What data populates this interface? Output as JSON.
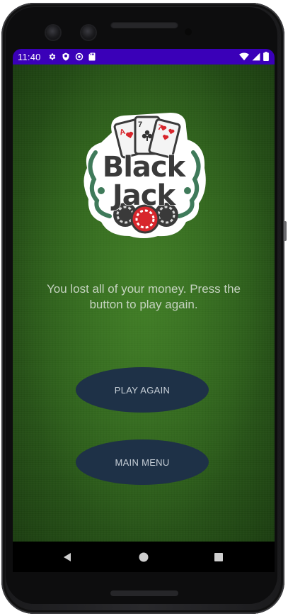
{
  "status_bar": {
    "time": "11:40",
    "left_icons": [
      "gear-icon",
      "shield-icon",
      "sync-icon",
      "sd-card-icon"
    ],
    "right_icons": [
      "wifi-icon",
      "cell-signal-icon",
      "battery-icon"
    ],
    "color": "#3a00b8"
  },
  "logo": {
    "line1": "Black",
    "line2": "Jack"
  },
  "message": "You lost all of your money. Press the button to play again.",
  "buttons": {
    "play_again": "PLAY AGAIN",
    "main_menu": "MAIN MENU"
  },
  "nav": {
    "items": [
      "back-icon",
      "home-icon",
      "recents-icon"
    ]
  },
  "colors": {
    "felt": "#2b5c1a",
    "button": "#1e3147",
    "button_text": "#c8d0d8"
  }
}
